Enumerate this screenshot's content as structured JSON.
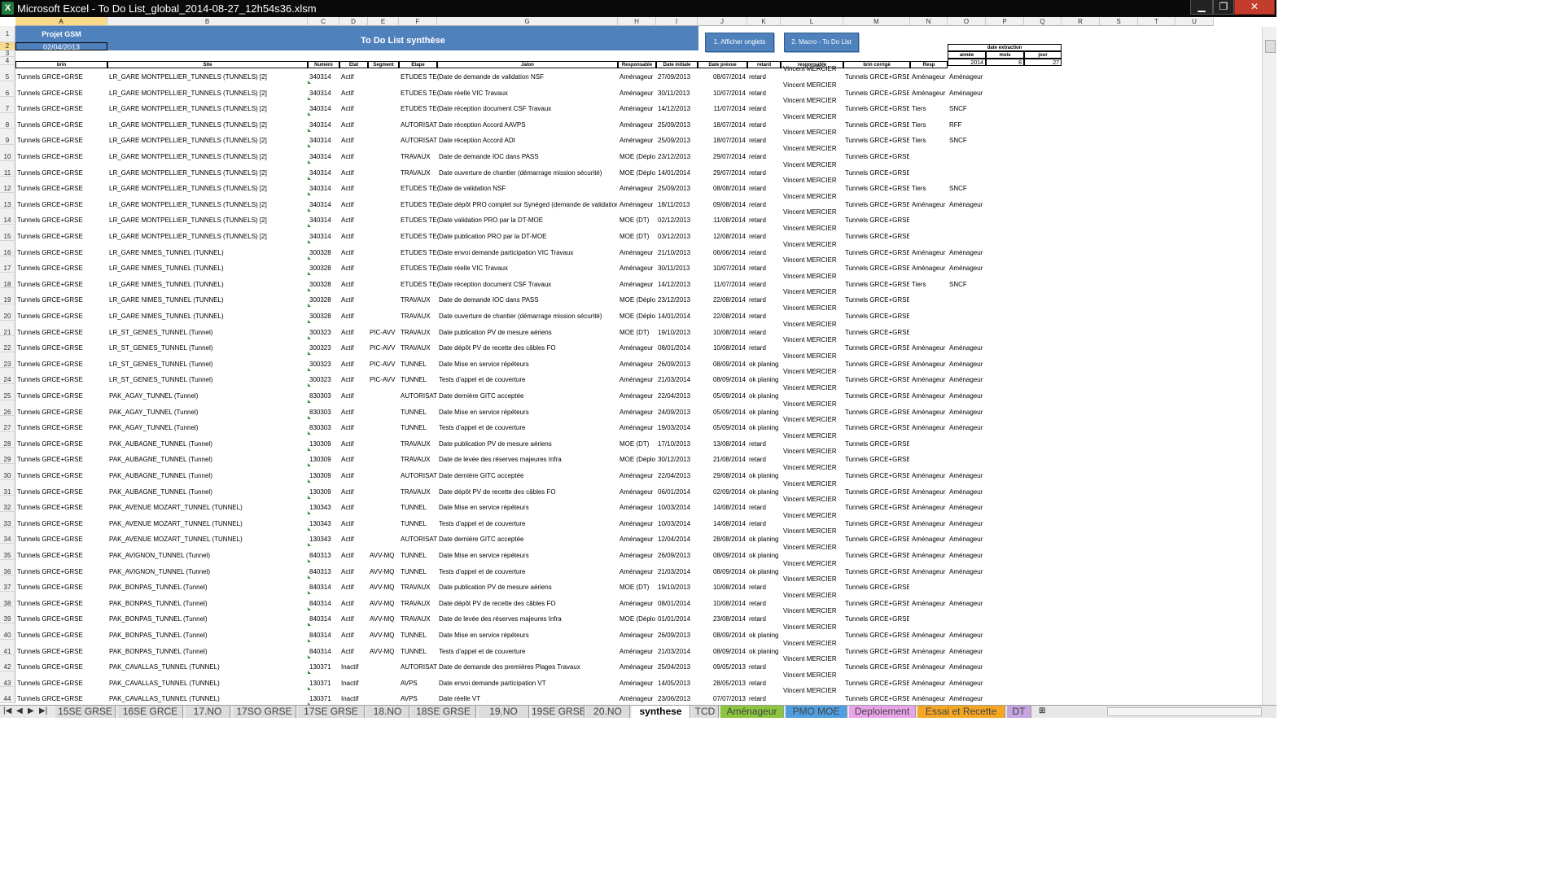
{
  "window": {
    "title": "Microsoft Excel - To Do List_global_2014-08-27_12h54s36.xlsm",
    "app_icon": "X",
    "minimize": "▁",
    "maximize": "❐",
    "close": "✕"
  },
  "columns": [
    "A",
    "B",
    "C",
    "D",
    "E",
    "F",
    "G",
    "H",
    "I",
    "J",
    "K",
    "L",
    "M",
    "N",
    "O",
    "P",
    "Q",
    "R",
    "S",
    "T",
    "U"
  ],
  "selected_column": "A",
  "project": {
    "label": "Projet GSM",
    "date": "02/04/2013"
  },
  "banner_title": "To Do List synthèse",
  "buttons": {
    "show_tabs": "1. Afficher onglets",
    "macro": "2. Macro - To Do List"
  },
  "extraction": {
    "title": "date extraction",
    "labels": [
      "année",
      "mois",
      "jour"
    ],
    "values": [
      "2014",
      "8",
      "27"
    ]
  },
  "headers": [
    "brin",
    "Site",
    "Numéro",
    "Etat",
    "Segment",
    "Etape",
    "Jalon",
    "Responsable",
    "Date initiale",
    "Date prévue",
    "retard",
    "responsable",
    "brin corrigé",
    "Resp"
  ],
  "rows": [
    [
      "5",
      "Tunnels GRCE+GRSE",
      "LR_GARE MONTPELLIER_TUNNELS (TUNNELS) [2]",
      "340314",
      "Actif",
      "",
      "ETUDES TE(",
      "Date de demande de validation NSF",
      "Aménageur",
      "27/09/2013",
      "08/07/2014",
      "retard",
      "Vincent MERCIER",
      "Tunnels GRCE+GRSE",
      "Aménageur",
      "Aménageur"
    ],
    [
      "6",
      "Tunnels GRCE+GRSE",
      "LR_GARE MONTPELLIER_TUNNELS (TUNNELS) [2]",
      "340314",
      "Actif",
      "",
      "ETUDES TE(",
      "Date réelle VIC Travaux",
      "Aménageur",
      "30/11/2013",
      "10/07/2014",
      "retard",
      "Vincent MERCIER",
      "Tunnels GRCE+GRSE",
      "Aménageur",
      "Aménageur"
    ],
    [
      "7",
      "Tunnels GRCE+GRSE",
      "LR_GARE MONTPELLIER_TUNNELS (TUNNELS) [2]",
      "340314",
      "Actif",
      "",
      "ETUDES TE(",
      "Date réception document CSF Travaux",
      "Aménageur",
      "14/12/2013",
      "11/07/2014",
      "retard",
      "Vincent MERCIER",
      "Tunnels GRCE+GRSE",
      "Tiers",
      "SNCF"
    ],
    [
      "8",
      "Tunnels GRCE+GRSE",
      "LR_GARE MONTPELLIER_TUNNELS (TUNNELS) [2]",
      "340314",
      "Actif",
      "",
      "AUTORISAT",
      "Date réception Accord AAVPS",
      "Aménageur",
      "25/09/2013",
      "18/07/2014",
      "retard",
      "Vincent MERCIER",
      "Tunnels GRCE+GRSE",
      "Tiers",
      "RFF"
    ],
    [
      "9",
      "Tunnels GRCE+GRSE",
      "LR_GARE MONTPELLIER_TUNNELS (TUNNELS) [2]",
      "340314",
      "Actif",
      "",
      "AUTORISAT",
      "Date réception Accord ADI",
      "Aménageur",
      "25/09/2013",
      "18/07/2014",
      "retard",
      "Vincent MERCIER",
      "Tunnels GRCE+GRSE",
      "Tiers",
      "SNCF"
    ],
    [
      "10",
      "Tunnels GRCE+GRSE",
      "LR_GARE MONTPELLIER_TUNNELS (TUNNELS) [2]",
      "340314",
      "Actif",
      "",
      "TRAVAUX",
      "Date de demande IOC dans PASS",
      "MOE (Déploi",
      "23/12/2013",
      "29/07/2014",
      "retard",
      "Vincent MERCIER",
      "Tunnels GRCE+GRSE",
      "",
      ""
    ],
    [
      "11",
      "Tunnels GRCE+GRSE",
      "LR_GARE MONTPELLIER_TUNNELS (TUNNELS) [2]",
      "340314",
      "Actif",
      "",
      "TRAVAUX",
      "Date ouverture de chantier (démarrage mission sécurité)",
      "MOE (Déploi",
      "14/01/2014",
      "29/07/2014",
      "retard",
      "Vincent MERCIER",
      "Tunnels GRCE+GRSE",
      "",
      ""
    ],
    [
      "12",
      "Tunnels GRCE+GRSE",
      "LR_GARE MONTPELLIER_TUNNELS (TUNNELS) [2]",
      "340314",
      "Actif",
      "",
      "ETUDES TE(",
      "Date de validation NSF",
      "Aménageur",
      "25/09/2013",
      "08/08/2014",
      "retard",
      "Vincent MERCIER",
      "Tunnels GRCE+GRSE",
      "Tiers",
      "SNCF"
    ],
    [
      "13",
      "Tunnels GRCE+GRSE",
      "LR_GARE MONTPELLIER_TUNNELS (TUNNELS) [2]",
      "340314",
      "Actif",
      "",
      "ETUDES TE(",
      "Date dépôt PRO complet sur Synéged (demande de validation)",
      "Aménageur",
      "18/11/2013",
      "09/08/2014",
      "retard",
      "Vincent MERCIER",
      "Tunnels GRCE+GRSE",
      "Aménageur",
      "Aménageur"
    ],
    [
      "14",
      "Tunnels GRCE+GRSE",
      "LR_GARE MONTPELLIER_TUNNELS (TUNNELS) [2]",
      "340314",
      "Actif",
      "",
      "ETUDES TE(",
      "Date validation PRO par la DT-MOE",
      "MOE (DT)",
      "02/12/2013",
      "11/08/2014",
      "retard",
      "Vincent MERCIER",
      "Tunnels GRCE+GRSE",
      "",
      ""
    ],
    [
      "15",
      "Tunnels GRCE+GRSE",
      "LR_GARE MONTPELLIER_TUNNELS (TUNNELS) [2]",
      "340314",
      "Actif",
      "",
      "ETUDES TE(",
      "Date publication PRO par la DT-MOE",
      "MOE (DT)",
      "03/12/2013",
      "12/08/2014",
      "retard",
      "Vincent MERCIER",
      "Tunnels GRCE+GRSE",
      "",
      ""
    ],
    [
      "16",
      "Tunnels GRCE+GRSE",
      "LR_GARE NIMES_TUNNEL (TUNNEL)",
      "300328",
      "Actif",
      "",
      "ETUDES TE(",
      "Date envoi demande participation VIC Travaux",
      "Aménageur",
      "21/10/2013",
      "06/06/2014",
      "retard",
      "Vincent MERCIER",
      "Tunnels GRCE+GRSE",
      "Aménageur",
      "Aménageur"
    ],
    [
      "17",
      "Tunnels GRCE+GRSE",
      "LR_GARE NIMES_TUNNEL (TUNNEL)",
      "300328",
      "Actif",
      "",
      "ETUDES TE(",
      "Date réelle VIC Travaux",
      "Aménageur",
      "30/11/2013",
      "10/07/2014",
      "retard",
      "Vincent MERCIER",
      "Tunnels GRCE+GRSE",
      "Aménageur",
      "Aménageur"
    ],
    [
      "18",
      "Tunnels GRCE+GRSE",
      "LR_GARE NIMES_TUNNEL (TUNNEL)",
      "300328",
      "Actif",
      "",
      "ETUDES TE(",
      "Date réception document CSF Travaux",
      "Aménageur",
      "14/12/2013",
      "11/07/2014",
      "retard",
      "Vincent MERCIER",
      "Tunnels GRCE+GRSE",
      "Tiers",
      "SNCF"
    ],
    [
      "19",
      "Tunnels GRCE+GRSE",
      "LR_GARE NIMES_TUNNEL (TUNNEL)",
      "300328",
      "Actif",
      "",
      "TRAVAUX",
      "Date de demande IOC dans PASS",
      "MOE (Déploi",
      "23/12/2013",
      "22/08/2014",
      "retard",
      "Vincent MERCIER",
      "Tunnels GRCE+GRSE",
      "",
      ""
    ],
    [
      "20",
      "Tunnels GRCE+GRSE",
      "LR_GARE NIMES_TUNNEL (TUNNEL)",
      "300328",
      "Actif",
      "",
      "TRAVAUX",
      "Date ouverture de chantier (démarrage mission sécurité)",
      "MOE (Déploi",
      "14/01/2014",
      "22/08/2014",
      "retard",
      "Vincent MERCIER",
      "Tunnels GRCE+GRSE",
      "",
      ""
    ],
    [
      "21",
      "Tunnels GRCE+GRSE",
      "LR_ST_GENIES_TUNNEL (Tunnel)",
      "300323",
      "Actif",
      "PIC-AVV",
      "TRAVAUX",
      "Date publication PV de mesure aériens",
      "MOE (DT)",
      "19/10/2013",
      "10/08/2014",
      "retard",
      "Vincent MERCIER",
      "Tunnels GRCE+GRSE",
      "",
      ""
    ],
    [
      "22",
      "Tunnels GRCE+GRSE",
      "LR_ST_GENIES_TUNNEL (Tunnel)",
      "300323",
      "Actif",
      "PIC-AVV",
      "TRAVAUX",
      "Date dépôt PV de recette des câbles FO",
      "Aménageur",
      "08/01/2014",
      "10/08/2014",
      "retard",
      "Vincent MERCIER",
      "Tunnels GRCE+GRSE",
      "Aménageur",
      "Aménageur"
    ],
    [
      "23",
      "Tunnels GRCE+GRSE",
      "LR_ST_GENIES_TUNNEL (Tunnel)",
      "300323",
      "Actif",
      "PIC-AVV",
      "TUNNEL",
      "Date Mise en service répéteurs",
      "Aménageur",
      "26/09/2013",
      "08/09/2014",
      "ok planing",
      "Vincent MERCIER",
      "Tunnels GRCE+GRSE",
      "Aménageur",
      "Aménageur"
    ],
    [
      "24",
      "Tunnels GRCE+GRSE",
      "LR_ST_GENIES_TUNNEL (Tunnel)",
      "300323",
      "Actif",
      "PIC-AVV",
      "TUNNEL",
      "Tests d'appel et de couverture",
      "Aménageur",
      "21/03/2014",
      "08/09/2014",
      "ok planing",
      "Vincent MERCIER",
      "Tunnels GRCE+GRSE",
      "Aménageur",
      "Aménageur"
    ],
    [
      "25",
      "Tunnels GRCE+GRSE",
      "PAK_AGAY_TUNNEL (Tunnel)",
      "830303",
      "Actif",
      "",
      "AUTORISAT",
      "Date dernière GITC acceptée",
      "Aménageur",
      "22/04/2013",
      "05/09/2014",
      "ok planing",
      "Vincent MERCIER",
      "Tunnels GRCE+GRSE",
      "Aménageur",
      "Aménageur"
    ],
    [
      "26",
      "Tunnels GRCE+GRSE",
      "PAK_AGAY_TUNNEL (Tunnel)",
      "830303",
      "Actif",
      "",
      "TUNNEL",
      "Date Mise en service répéteurs",
      "Aménageur",
      "24/09/2013",
      "05/09/2014",
      "ok planing",
      "Vincent MERCIER",
      "Tunnels GRCE+GRSE",
      "Aménageur",
      "Aménageur"
    ],
    [
      "27",
      "Tunnels GRCE+GRSE",
      "PAK_AGAY_TUNNEL (Tunnel)",
      "830303",
      "Actif",
      "",
      "TUNNEL",
      "Tests d'appel et de couverture",
      "Aménageur",
      "19/03/2014",
      "05/09/2014",
      "ok planing",
      "Vincent MERCIER",
      "Tunnels GRCE+GRSE",
      "Aménageur",
      "Aménageur"
    ],
    [
      "28",
      "Tunnels GRCE+GRSE",
      "PAK_AUBAGNE_TUNNEL (Tunnel)",
      "130309",
      "Actif",
      "",
      "TRAVAUX",
      "Date publication PV de mesure aériens",
      "MOE (DT)",
      "17/10/2013",
      "13/08/2014",
      "retard",
      "Vincent MERCIER",
      "Tunnels GRCE+GRSE",
      "",
      ""
    ],
    [
      "29",
      "Tunnels GRCE+GRSE",
      "PAK_AUBAGNE_TUNNEL (Tunnel)",
      "130309",
      "Actif",
      "",
      "TRAVAUX",
      "Date de levée des réserves majeures Infra",
      "MOE (Déploi",
      "30/12/2013",
      "21/08/2014",
      "retard",
      "Vincent MERCIER",
      "Tunnels GRCE+GRSE",
      "",
      ""
    ],
    [
      "30",
      "Tunnels GRCE+GRSE",
      "PAK_AUBAGNE_TUNNEL (Tunnel)",
      "130309",
      "Actif",
      "",
      "AUTORISAT",
      "Date dernière GITC acceptée",
      "Aménageur",
      "22/04/2013",
      "29/08/2014",
      "ok planing",
      "Vincent MERCIER",
      "Tunnels GRCE+GRSE",
      "Aménageur",
      "Aménageur"
    ],
    [
      "31",
      "Tunnels GRCE+GRSE",
      "PAK_AUBAGNE_TUNNEL (Tunnel)",
      "130309",
      "Actif",
      "",
      "TRAVAUX",
      "Date dépôt PV de recette des câbles FO",
      "Aménageur",
      "06/01/2014",
      "02/09/2014",
      "ok planing",
      "Vincent MERCIER",
      "Tunnels GRCE+GRSE",
      "Aménageur",
      "Aménageur"
    ],
    [
      "32",
      "Tunnels GRCE+GRSE",
      "PAK_AVENUE MOZART_TUNNEL (TUNNEL)",
      "130343",
      "Actif",
      "",
      "TUNNEL",
      "Date Mise en service répéteurs",
      "Aménageur",
      "10/03/2014",
      "14/08/2014",
      "retard",
      "Vincent MERCIER",
      "Tunnels GRCE+GRSE",
      "Aménageur",
      "Aménageur"
    ],
    [
      "33",
      "Tunnels GRCE+GRSE",
      "PAK_AVENUE MOZART_TUNNEL (TUNNEL)",
      "130343",
      "Actif",
      "",
      "TUNNEL",
      "Tests d'appel et de couverture",
      "Aménageur",
      "10/03/2014",
      "14/08/2014",
      "retard",
      "Vincent MERCIER",
      "Tunnels GRCE+GRSE",
      "Aménageur",
      "Aménageur"
    ],
    [
      "34",
      "Tunnels GRCE+GRSE",
      "PAK_AVENUE MOZART_TUNNEL (TUNNEL)",
      "130343",
      "Actif",
      "",
      "AUTORISAT",
      "Date dernière GITC acceptée",
      "Aménageur",
      "12/04/2014",
      "28/08/2014",
      "ok planing",
      "Vincent MERCIER",
      "Tunnels GRCE+GRSE",
      "Aménageur",
      "Aménageur"
    ],
    [
      "35",
      "Tunnels GRCE+GRSE",
      "PAK_AVIGNON_TUNNEL (Tunnel)",
      "840313",
      "Actif",
      "AVV-MQ",
      "TUNNEL",
      "Date Mise en service répéteurs",
      "Aménageur",
      "26/09/2013",
      "08/09/2014",
      "ok planing",
      "Vincent MERCIER",
      "Tunnels GRCE+GRSE",
      "Aménageur",
      "Aménageur"
    ],
    [
      "36",
      "Tunnels GRCE+GRSE",
      "PAK_AVIGNON_TUNNEL (Tunnel)",
      "840313",
      "Actif",
      "AVV-MQ",
      "TUNNEL",
      "Tests d'appel et de couverture",
      "Aménageur",
      "21/03/2014",
      "08/09/2014",
      "ok planing",
      "Vincent MERCIER",
      "Tunnels GRCE+GRSE",
      "Aménageur",
      "Aménageur"
    ],
    [
      "37",
      "Tunnels GRCE+GRSE",
      "PAK_BONPAS_TUNNEL (Tunnel)",
      "840314",
      "Actif",
      "AVV-MQ",
      "TRAVAUX",
      "Date publication PV de mesure aériens",
      "MOE (DT)",
      "19/10/2013",
      "10/08/2014",
      "retard",
      "Vincent MERCIER",
      "Tunnels GRCE+GRSE",
      "",
      ""
    ],
    [
      "38",
      "Tunnels GRCE+GRSE",
      "PAK_BONPAS_TUNNEL (Tunnel)",
      "840314",
      "Actif",
      "AVV-MQ",
      "TRAVAUX",
      "Date dépôt PV de recette des câbles FO",
      "Aménageur",
      "08/01/2014",
      "10/08/2014",
      "retard",
      "Vincent MERCIER",
      "Tunnels GRCE+GRSE",
      "Aménageur",
      "Aménageur"
    ],
    [
      "39",
      "Tunnels GRCE+GRSE",
      "PAK_BONPAS_TUNNEL (Tunnel)",
      "840314",
      "Actif",
      "AVV-MQ",
      "TRAVAUX",
      "Date de levée des réserves majeures Infra",
      "MOE (Déploi",
      "01/01/2014",
      "23/08/2014",
      "retard",
      "Vincent MERCIER",
      "Tunnels GRCE+GRSE",
      "",
      ""
    ],
    [
      "40",
      "Tunnels GRCE+GRSE",
      "PAK_BONPAS_TUNNEL (Tunnel)",
      "840314",
      "Actif",
      "AVV-MQ",
      "TUNNEL",
      "Date Mise en service répéteurs",
      "Aménageur",
      "26/09/2013",
      "08/09/2014",
      "ok planing",
      "Vincent MERCIER",
      "Tunnels GRCE+GRSE",
      "Aménageur",
      "Aménageur"
    ],
    [
      "41",
      "Tunnels GRCE+GRSE",
      "PAK_BONPAS_TUNNEL (Tunnel)",
      "840314",
      "Actif",
      "AVV-MQ",
      "TUNNEL",
      "Tests d'appel et de couverture",
      "Aménageur",
      "21/03/2014",
      "08/09/2014",
      "ok planing",
      "Vincent MERCIER",
      "Tunnels GRCE+GRSE",
      "Aménageur",
      "Aménageur"
    ],
    [
      "42",
      "Tunnels GRCE+GRSE",
      "PAK_CAVALLAS_TUNNEL (TUNNEL)",
      "130371",
      "Inactif",
      "",
      "AUTORISAT",
      "Date de demande des premières Plages Travaux",
      "Aménageur",
      "25/04/2013",
      "09/05/2013",
      "retard",
      "Vincent MERCIER",
      "Tunnels GRCE+GRSE",
      "Aménageur",
      "Aménageur"
    ],
    [
      "43",
      "Tunnels GRCE+GRSE",
      "PAK_CAVALLAS_TUNNEL (TUNNEL)",
      "130371",
      "Inactif",
      "",
      "AVPS",
      "Date envoi demande participation VT",
      "Aménageur",
      "14/05/2013",
      "28/05/2013",
      "retard",
      "Vincent MERCIER",
      "Tunnels GRCE+GRSE",
      "Aménageur",
      "Aménageur"
    ],
    [
      "44",
      "Tunnels GRCE+GRSE",
      "PAK_CAVALLAS_TUNNEL (TUNNEL)",
      "130371",
      "Inactif",
      "",
      "AVPS",
      "Date réelle VT",
      "Aménageur",
      "23/06/2013",
      "07/07/2013",
      "retard",
      "Vincent MERCIER",
      "Tunnels GRCE+GRSE",
      "Aménageur",
      "Aménageur"
    ]
  ],
  "sheet_tabs": [
    {
      "label": "15SE GRSE",
      "color": "#dcdcdc"
    },
    {
      "label": "16SE GRCE",
      "color": "#dcdcdc"
    },
    {
      "label": "17.NO",
      "color": "#dcdcdc"
    },
    {
      "label": "17SO GRSE",
      "color": "#dcdcdc"
    },
    {
      "label": "17SE GRSE",
      "color": "#dcdcdc"
    },
    {
      "label": "18.NO",
      "color": "#dcdcdc"
    },
    {
      "label": "18SE GRSE",
      "color": "#dcdcdc"
    },
    {
      "label": "19.NO",
      "color": "#dcdcdc"
    },
    {
      "label": "19SE GRSE",
      "color": "#dcdcdc"
    },
    {
      "label": "20.NO",
      "color": "#dcdcdc"
    },
    {
      "label": "synthese",
      "color": "#ffffff",
      "active": true
    },
    {
      "label": "TCD",
      "color": "#dcdcdc"
    },
    {
      "label": "Aménageur",
      "color": "#8cc63f"
    },
    {
      "label": "PMO MOE",
      "color": "#4f9fe0"
    },
    {
      "label": "Deploiement",
      "color": "#e9a3e9"
    },
    {
      "label": "Essai et Recette",
      "color": "#f5a623"
    },
    {
      "label": "DT",
      "color": "#c4a5e0"
    }
  ],
  "colors": {
    "banner": "#4f81bd",
    "header_bg": "#f0f0f0",
    "active_header": "#f9d98a",
    "flag": "#2e8b2e"
  }
}
